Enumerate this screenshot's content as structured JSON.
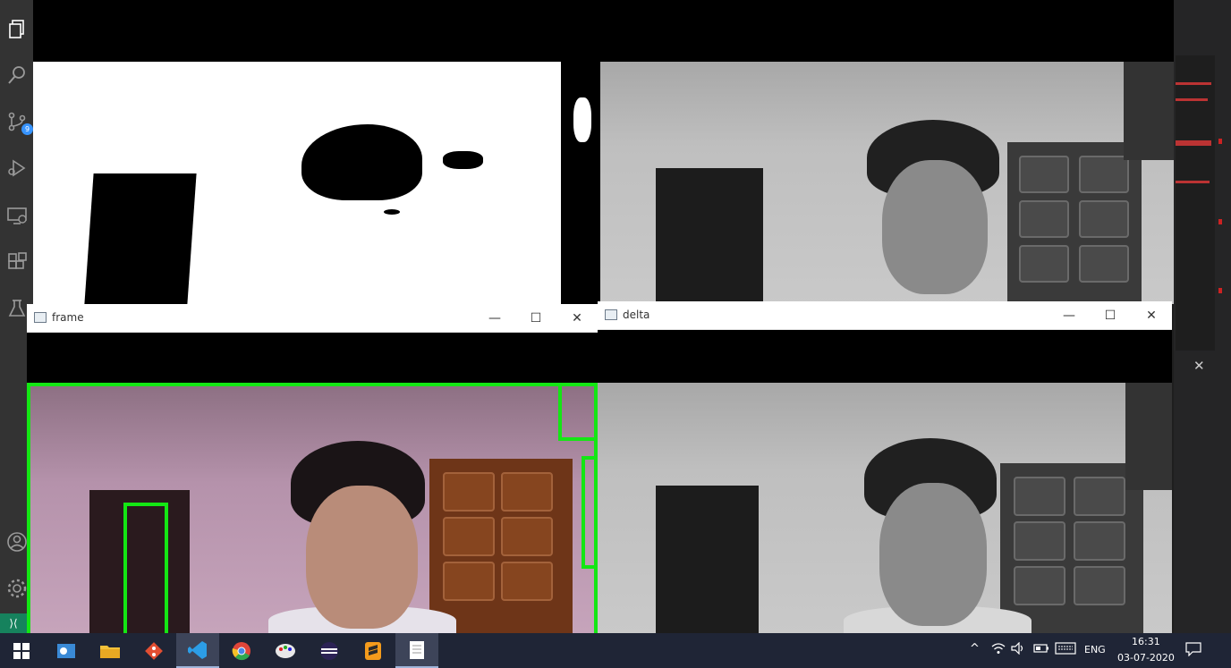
{
  "windows": {
    "thresh": {
      "title": ""
    },
    "gray": {
      "title": ""
    },
    "frame": {
      "title": "frame"
    },
    "delta": {
      "title": "delta"
    }
  },
  "window_controls": {
    "minimize": "—",
    "maximize": "☐",
    "close": "✕"
  },
  "activity_bar": {
    "items": [
      "explorer-icon",
      "search-icon",
      "source-control-icon",
      "run-debug-icon",
      "remote-explorer-icon",
      "extensions-icon",
      "testing-icon",
      "account-icon",
      "settings-gear-icon"
    ],
    "source_control_badge": "9",
    "remote_symbol": "⟩⟨"
  },
  "editor_strip": {
    "close_symbol": "✕"
  },
  "taskbar": {
    "apps": [
      "start",
      "outlook",
      "file-explorer",
      "git",
      "vscode",
      "chrome",
      "paint",
      "eclipse",
      "sublime",
      "notepad"
    ],
    "tray": {
      "language": "ENG",
      "time": "16:31",
      "date": "03-07-2020"
    }
  },
  "colors": {
    "bbox": "#14e614",
    "taskbar": "#1f2536",
    "activity_bar": "#333333"
  }
}
